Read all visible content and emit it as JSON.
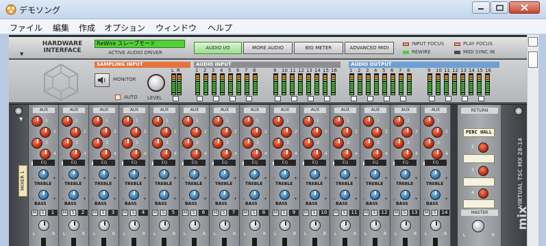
{
  "window": {
    "title": "デモソング"
  },
  "menu": [
    "ファイル",
    "編集",
    "作成",
    "オプション",
    "ウィンドウ",
    "ヘルプ"
  ],
  "hardware_interface": {
    "title_line1": "HARDWARE",
    "title_line2": "INTERFACE",
    "driver": "ReWire スレーブモード",
    "driver_label": "ACTIVE AUDIO DRIVER",
    "tabs": [
      "AUDIO I/O",
      "MORE AUDIO",
      "BIG METER",
      "ADVANCED MIDI"
    ],
    "active_tab": "AUDIO I/O",
    "indicators": [
      {
        "label": "INPUT FOCUS",
        "color": "#e89a78"
      },
      {
        "label": "PLAY FOCUS",
        "color": "#e89a78"
      },
      {
        "label": "REWIRE",
        "color": "#52cf39"
      },
      {
        "label": "MIDI SYNC IN",
        "color": "#4a4a4a"
      }
    ]
  },
  "audio_io": {
    "sampling_input": "SAMPLING INPUT",
    "monitor": "MONITOR",
    "auto": "AUTO",
    "level": "LEVEL",
    "audio_input": "AUDIO INPUT",
    "audio_output": "AUDIO OUTPUT",
    "sampling_channels": [
      "L",
      "R"
    ],
    "input_channels": [
      "1",
      "2",
      "3",
      "4",
      "5",
      "6",
      "7",
      "8",
      "9",
      "10",
      "11",
      "12",
      "13",
      "14",
      "15",
      "16"
    ],
    "output_channels": [
      "1",
      "2",
      "3",
      "4",
      "5",
      "6",
      "7",
      "8",
      "9",
      "10",
      "11",
      "12",
      "13",
      "14",
      "15",
      "16"
    ],
    "colors": {
      "sampling": "#e3733f",
      "input": "#8c8e91",
      "output": "#6d9fd3"
    }
  },
  "mixer": {
    "device_label": "MIXER 1",
    "model": "VIRTUAL TSC MX 28-14",
    "logo": "mix",
    "aux_label": "AUX",
    "aux_numbers": [
      "1",
      "2",
      "3",
      "4"
    ],
    "eq_label": "EQ",
    "treble_label": "TREBLE",
    "bass_label": "BASS",
    "mute_label": "M",
    "solo_label": "S",
    "pan_l": "L",
    "pan_r": "R",
    "channels": [
      "1",
      "2",
      "3",
      "4",
      "5",
      "6",
      "7",
      "8",
      "9",
      "10",
      "11",
      "12",
      "13",
      "14"
    ],
    "return_label": "RETURN",
    "returns": [
      "PERC HALL",
      "",
      "",
      ""
    ],
    "return_numbers": [
      "1",
      "2",
      "3",
      "4"
    ],
    "master_label": "MASTER"
  }
}
